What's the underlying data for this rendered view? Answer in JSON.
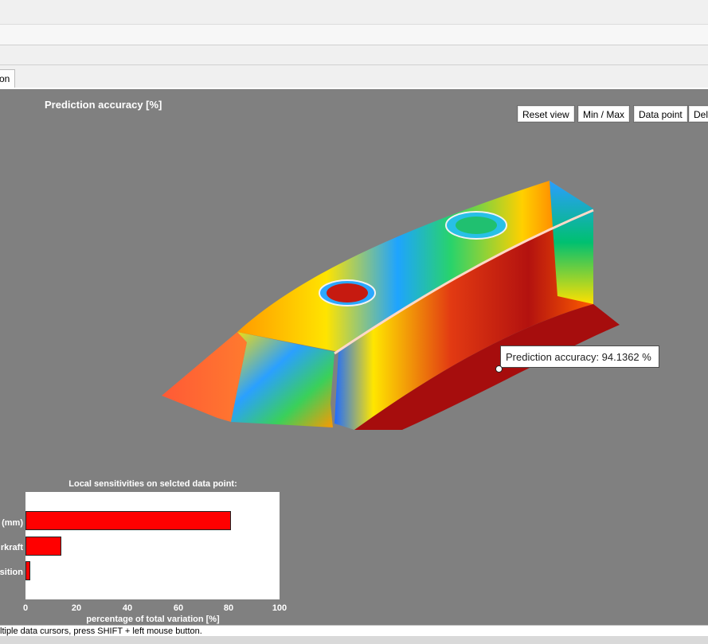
{
  "tab": {
    "label": "on"
  },
  "plot": {
    "title": "Prediction accuracy [%]",
    "buttons": [
      "Reset view",
      "Min / Max",
      "Data point",
      "Del"
    ],
    "tooltip": "Prediction accuracy: 94.1362 %"
  },
  "sensitivity": {
    "title": "Local sensitivities on selcted data point:",
    "labels": [
      "(mm)",
      "rkraft",
      "sition"
    ],
    "values": [
      81,
      14,
      2
    ],
    "xticks": [
      "0",
      "20",
      "40",
      "60",
      "80",
      "100"
    ],
    "xlabel": "percentage of total variation [%]",
    "xlim": [
      0,
      100
    ]
  },
  "status": "ltiple data cursors, press SHIFT + left mouse button.",
  "colors": {
    "background": "#808080",
    "bar": "#ff0000"
  }
}
